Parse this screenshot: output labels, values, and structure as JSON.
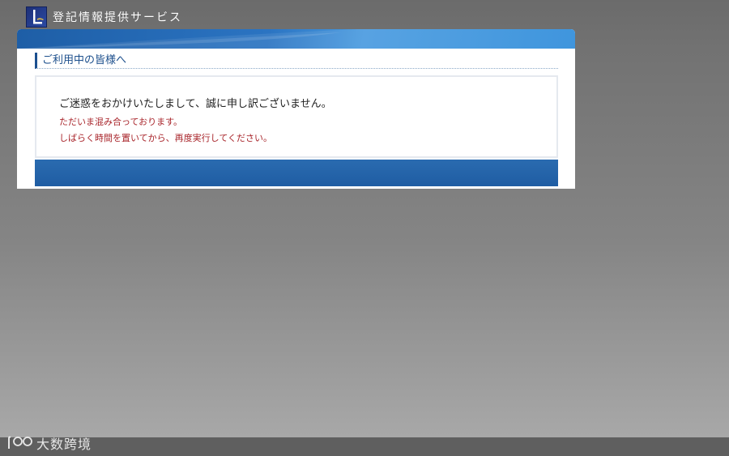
{
  "header": {
    "site_title": "登記情報提供サービス",
    "logo_icon": "registry-logo-icon"
  },
  "notice_panel": {
    "section_title": "ご利用中の皆様へ",
    "apology": "ご迷惑をおかけいたしまして、誠に申し訳ございません。",
    "busy_message": "ただいま混み合っております。",
    "retry_message": "しばらく時間を置いてから、再度実行してください。"
  },
  "watermark": {
    "text": "大数跨境"
  },
  "colors": {
    "accent_blue": "#1f5da3",
    "alert_red": "#a8242a",
    "title_blue": "#1c4f8c"
  }
}
